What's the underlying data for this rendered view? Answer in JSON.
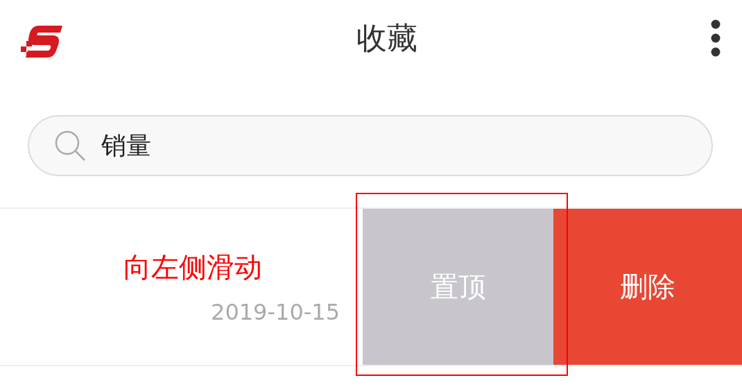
{
  "header": {
    "title": "收藏"
  },
  "search": {
    "value": "销量"
  },
  "items": [
    {
      "date": "2019-10-15",
      "annotation": "向左侧滑动",
      "actions": [
        {
          "kind": "pin",
          "label": "置顶"
        },
        {
          "kind": "delete",
          "label": "删除"
        }
      ]
    }
  ]
}
